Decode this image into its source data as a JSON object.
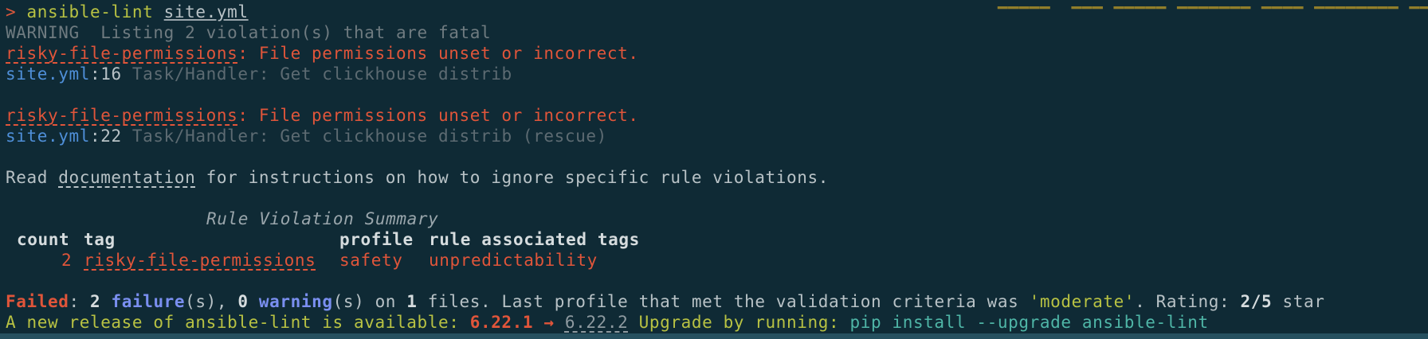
{
  "terminal": {
    "cut_top_text": "                                                                                              ▁▁▁▁▁  ▁▁▁ ▁▁▁▁▁ ▁▁▁▁▁▁▁ ▁▁▁▁ ▁▁▁▁▁▁▁▁ ▁▁▁▁▁▁▁▁ ▁▁",
    "prompt_symbol": ">",
    "command": "ansible-lint",
    "command_arg": "site.yml",
    "warning_line": "WARNING  Listing 2 violation(s) that are fatal",
    "violations": [
      {
        "rule": "risky-file-permissions",
        "message": ": File permissions unset or incorrect.",
        "file": "site.yml",
        "line": ":16",
        "task": " Task/Handler: Get clickhouse distrib"
      },
      {
        "rule": "risky-file-permissions",
        "message": ": File permissions unset or incorrect.",
        "file": "site.yml",
        "line": ":22",
        "task": " Task/Handler: Get clickhouse distrib (rescue)"
      }
    ],
    "docs_pre": "Read ",
    "docs_link": "documentation",
    "docs_post": " for instructions on how to ignore specific rule violations.",
    "summary": {
      "title": "Rule Violation Summary",
      "headers": {
        "count": "count",
        "tag": "tag",
        "profile": "profile",
        "rule_tags": "rule associated tags"
      },
      "row": {
        "count": "2",
        "tag": "risky-file-permissions",
        "profile": "safety",
        "rule_tags": "unpredictability"
      }
    },
    "result": {
      "failed": "Failed",
      "part1": ": ",
      "failure_count": "2",
      "failure_word": "failure",
      "part2": "(s), ",
      "warning_count": "0",
      "warning_word": "warning",
      "part3": "(s) on ",
      "files_count": "1",
      "part4": " files. Last profile that met the validation criteria was ",
      "profile": "'moderate'",
      "part5": ". Rating: ",
      "rating": "2/5",
      "part6": " star"
    },
    "release": {
      "text": "A new release of ansible-lint is available: ",
      "current_version": "6.22.1",
      "arrow": " → ",
      "new_version": "6.22.2",
      "upgrade_text": " Upgrade by running: ",
      "command": "pip install --upgrade ansible-lint"
    }
  },
  "colors": {
    "background": "#0f2a35",
    "error": "#e0553a",
    "link": "#4f8fd8",
    "accent": "#b8c243",
    "keyword": "#7a8ff0",
    "command": "#4fb6a7"
  }
}
